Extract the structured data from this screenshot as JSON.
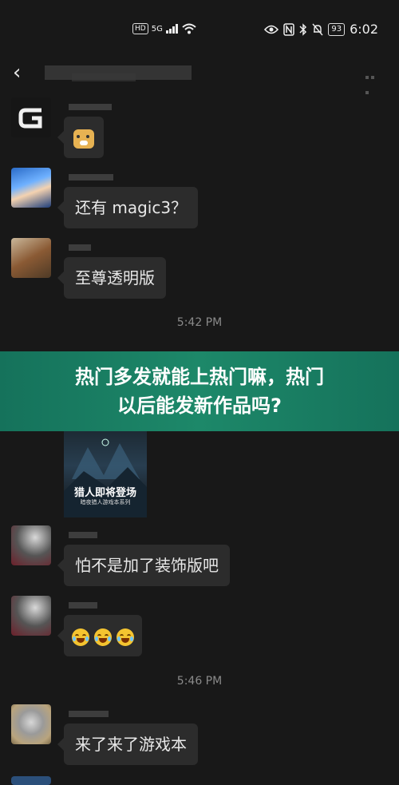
{
  "status_bar": {
    "hd_label": "HD",
    "network_label": "5G",
    "battery": "93",
    "time": "6:02"
  },
  "header": {
    "back_icon": "chevron-left-icon"
  },
  "messages": [
    {
      "type": "sticker",
      "sticker": "doge-sticker"
    },
    {
      "type": "text",
      "text": "还有 magic3？"
    },
    {
      "type": "text",
      "text": "至尊透明版"
    }
  ],
  "timestamps": [
    "5:42 PM",
    "5:46 PM"
  ],
  "banner": {
    "line1": "热门多发就能上热门嘛，热门",
    "line2": "以后能发新作品吗?"
  },
  "poster": {
    "title": "猎人即将登场",
    "subtitle": "暗夜猎人游戏本系列"
  },
  "messages2": [
    {
      "type": "text",
      "text": "怕不是加了装饰版吧"
    },
    {
      "type": "emoji",
      "emoji": [
        "laughing-crying-icon",
        "laughing-crying-icon",
        "laughing-crying-icon"
      ]
    },
    {
      "type": "text",
      "text": "来了来了游戏本"
    }
  ],
  "colors": {
    "background": "#181818",
    "bubble": "#2c2c2c",
    "banner": "#1d8869"
  }
}
